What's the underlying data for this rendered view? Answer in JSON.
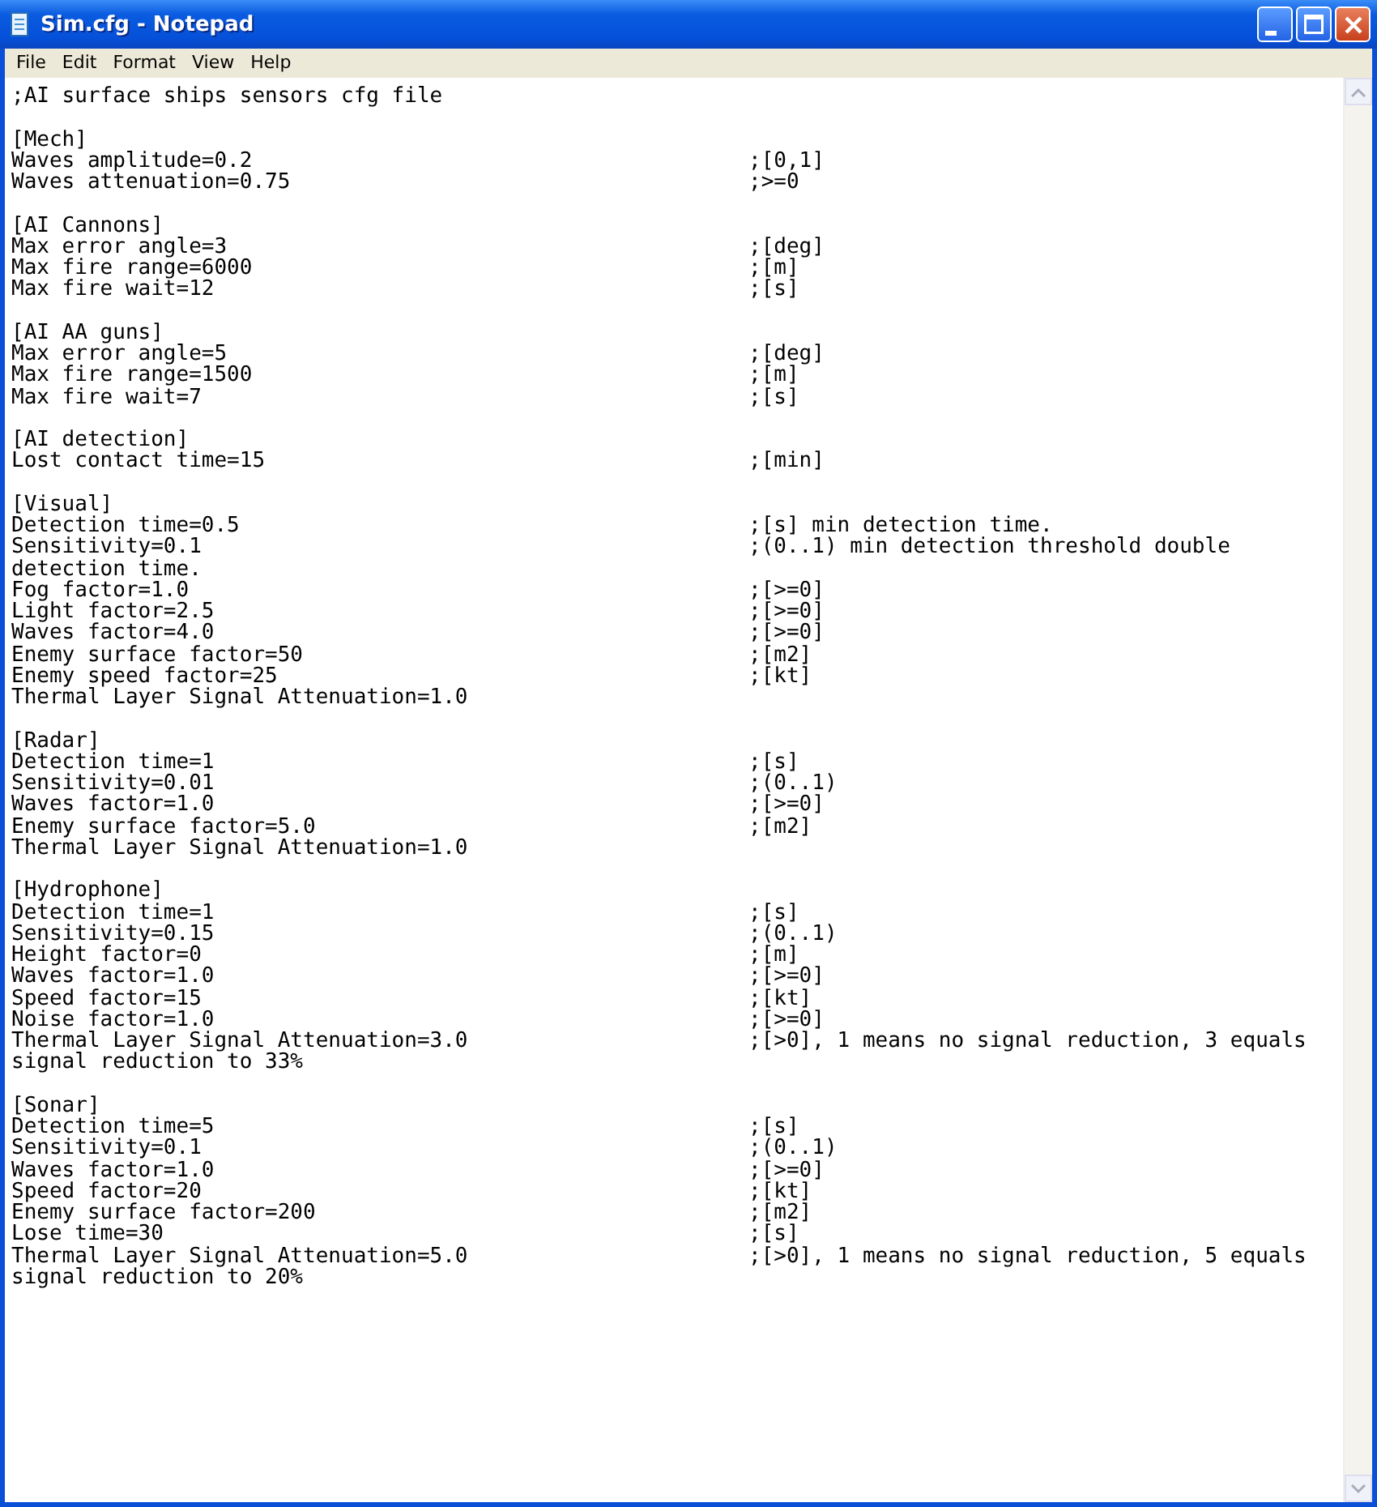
{
  "window": {
    "title": "Sim.cfg - Notepad"
  },
  "menu": [
    "File",
    "Edit",
    "Format",
    "View",
    "Help"
  ],
  "document": {
    "header": ";AI surface ships sensors cfg file",
    "sections": [
      {
        "lines": [
          {
            "text": "[Mech]"
          },
          {
            "text": "Waves amplitude=0.2",
            "comment": ";[0,1]"
          },
          {
            "text": "Waves attenuation=0.75",
            "comment": ";>=0"
          }
        ]
      },
      {
        "lines": [
          {
            "text": "[AI Cannons]"
          },
          {
            "text": "Max error angle=3",
            "comment": ";[deg]"
          },
          {
            "text": "Max fire range=6000",
            "comment": ";[m]"
          },
          {
            "text": "Max fire wait=12",
            "comment": ";[s]"
          }
        ]
      },
      {
        "lines": [
          {
            "text": "[AI AA guns]"
          },
          {
            "text": "Max error angle=5",
            "comment": ";[deg]"
          },
          {
            "text": "Max fire range=1500",
            "comment": ";[m]"
          },
          {
            "text": "Max fire wait=7",
            "comment": ";[s]"
          }
        ]
      },
      {
        "lines": [
          {
            "text": "[AI detection]"
          },
          {
            "text": "Lost contact time=15",
            "comment": ";[min]"
          }
        ]
      },
      {
        "lines": [
          {
            "text": "[Visual]"
          },
          {
            "text": "Detection time=0.5",
            "comment": ";[s] min detection time."
          },
          {
            "text": "Sensitivity=0.1",
            "comment": ";(0..1) min detection threshold double"
          },
          {
            "text": "detection time."
          },
          {
            "text": "Fog factor=1.0",
            "comment": ";[>=0]"
          },
          {
            "text": "Light factor=2.5",
            "comment": ";[>=0]"
          },
          {
            "text": "Waves factor=4.0",
            "comment": ";[>=0]"
          },
          {
            "text": "Enemy surface factor=50",
            "comment": ";[m2]"
          },
          {
            "text": "Enemy speed factor=25",
            "comment": ";[kt]"
          },
          {
            "text": "Thermal Layer Signal Attenuation=1.0"
          }
        ]
      },
      {
        "lines": [
          {
            "text": "[Radar]"
          },
          {
            "text": "Detection time=1",
            "comment": ";[s]"
          },
          {
            "text": "Sensitivity=0.01",
            "comment": ";(0..1)"
          },
          {
            "text": "Waves factor=1.0",
            "comment": ";[>=0]"
          },
          {
            "text": "Enemy surface factor=5.0",
            "comment": ";[m2]"
          },
          {
            "text": "Thermal Layer Signal Attenuation=1.0"
          }
        ]
      },
      {
        "lines": [
          {
            "text": "[Hydrophone]"
          },
          {
            "text": "Detection time=1",
            "comment": ";[s]"
          },
          {
            "text": "Sensitivity=0.15",
            "comment": ";(0..1)"
          },
          {
            "text": "Height factor=0",
            "comment": ";[m]"
          },
          {
            "text": "Waves factor=1.0",
            "comment": ";[>=0]"
          },
          {
            "text": "Speed factor=15",
            "comment": ";[kt]"
          },
          {
            "text": "Noise factor=1.0",
            "comment": ";[>=0]"
          },
          {
            "text": "Thermal Layer Signal Attenuation=3.0",
            "comment": ";[>0], 1 means no signal reduction, 3 equals"
          },
          {
            "text": "signal reduction to 33%"
          }
        ]
      },
      {
        "lines": [
          {
            "text": "[Sonar]"
          },
          {
            "text": "Detection time=5",
            "comment": ";[s]"
          },
          {
            "text": "Sensitivity=0.1",
            "comment": ";(0..1)"
          },
          {
            "text": "Waves factor=1.0",
            "comment": ";[>=0]"
          },
          {
            "text": "Speed factor=20",
            "comment": ";[kt]"
          },
          {
            "text": "Enemy surface factor=200",
            "comment": ";[m2]"
          },
          {
            "text": "Lose time=30",
            "comment": ";[s]"
          },
          {
            "text": "Thermal Layer Signal Attenuation=5.0",
            "comment": ";[>0], 1 means no signal reduction, 5 equals"
          },
          {
            "text": "signal reduction to 20%"
          }
        ]
      }
    ]
  }
}
